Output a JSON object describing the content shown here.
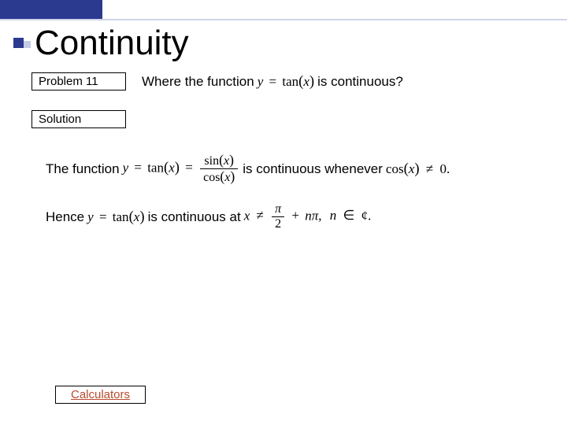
{
  "header": {
    "title": "Continuity"
  },
  "labels": {
    "problem": "Problem 11",
    "solution": "Solution",
    "calculators": "Calculators"
  },
  "prompt": {
    "pre": "Where the function",
    "eq_lhs": "y",
    "eq_eq": "=",
    "eq_fn": "tan",
    "eq_arg": "x",
    "post": "is continuous?"
  },
  "line1": {
    "pre": "The function",
    "eq_lhs": "y",
    "eq_eq": "=",
    "eq_fn1": "tan",
    "eq_arg": "x",
    "frac_num_fn": "sin",
    "frac_den_fn": "cos",
    "mid": "is continuous whenever",
    "cond_fn": "cos",
    "cond_rel": "≠",
    "cond_rhs": "0."
  },
  "line2": {
    "pre": "Hence",
    "eq_lhs": "y",
    "eq_eq": "=",
    "eq_fn": "tan",
    "eq_arg": "x",
    "mid": "is continuous at",
    "var": "x",
    "rel": "≠",
    "frac_num": "π",
    "frac_den": "2",
    "plus": "+",
    "n": "n",
    "pi": "π",
    "comma": ",",
    "nvar": "n",
    "in": "∈",
    "set": "¢",
    "dot": "."
  }
}
